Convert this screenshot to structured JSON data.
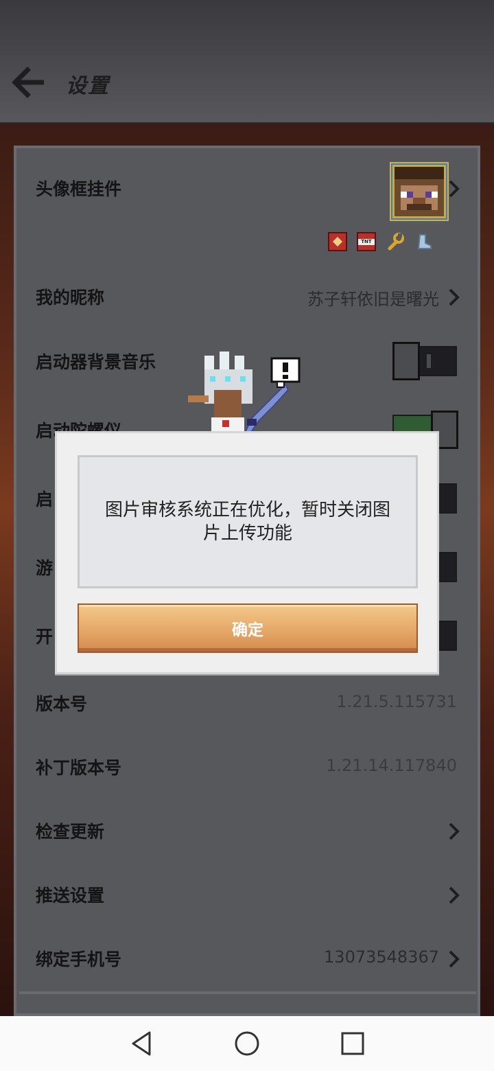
{
  "header": {
    "title": "设置"
  },
  "settings": {
    "avatar_frame": {
      "label": "头像框挂件"
    },
    "nickname": {
      "label": "我的昵称",
      "value": "苏子轩依旧是曙光"
    },
    "launcher_music": {
      "label": "启动器背景音乐",
      "state": "off"
    },
    "gyroscope": {
      "label": "启动陀螺仪",
      "state": "on"
    },
    "row5": {
      "label": "启",
      "state": "off"
    },
    "row6": {
      "label": "游",
      "state": "off"
    },
    "row7": {
      "label": "开",
      "state": "off"
    },
    "version": {
      "label": "版本号",
      "value": "1.21.5.115731"
    },
    "patch_version": {
      "label": "补丁版本号",
      "value": "1.21.14.117840"
    },
    "check_update": {
      "label": "检查更新"
    },
    "push_settings": {
      "label": "推送设置"
    },
    "bind_phone": {
      "label": "绑定手机号",
      "value": "13073548367"
    }
  },
  "badges": [
    "redstone-icon",
    "tnt-icon",
    "wrench-icon",
    "boot-icon"
  ],
  "badge_text": {
    "tnt": "TNT"
  },
  "dialog": {
    "message": "图片审核系统正在优化，暂时关闭图片上传功能",
    "ok_label": "确定"
  },
  "colors": {
    "toggle_on": "#2f5c33",
    "ok_button": "#e5a868"
  }
}
